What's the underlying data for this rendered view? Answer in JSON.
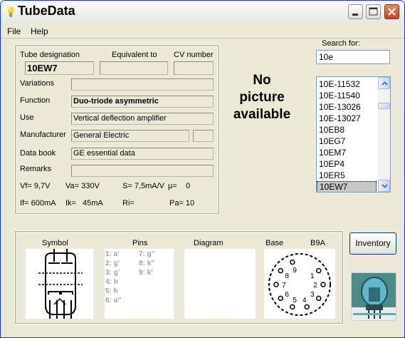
{
  "window": {
    "title": "TubeData"
  },
  "menu": {
    "file": "File",
    "help": "Help"
  },
  "designation": {
    "tube_label": "Tube designation",
    "equiv_label": "Equivalent to",
    "cv_label": "CV number",
    "tube_value": "10EW7",
    "equiv_value": "",
    "cv_value": ""
  },
  "details": {
    "variations_label": "Variations",
    "variations_value": "",
    "function_label": "Function",
    "function_value": "Duo-triode asymmetric",
    "use_label": "Use",
    "use_value": "Vertical deflection amplifier",
    "manufacturer_label": "Manufacturer",
    "manufacturer_value": "General Electric",
    "manufacturer_extra": "",
    "databook_label": "Data book",
    "databook_value": "GE essential data",
    "remarks_label": "Remarks",
    "remarks_value": ""
  },
  "params": {
    "vf": "Vf= 9,7V",
    "va": "Va= 330V",
    "s": "S= 7,5mA/V",
    "mu": "µ=",
    "mu_val": "0",
    "if": "If= 600mA",
    "ik": "Ik=",
    "ik_val": "45mA",
    "ri": "Ri=",
    "pa": "Pa= 10"
  },
  "picture": {
    "line1": "No",
    "line2": "picture",
    "line3": "available"
  },
  "search": {
    "label": "Search for:",
    "value": "10e",
    "results": [
      "10E-11532",
      "10E-11540",
      "10E-13026",
      "10E-13027",
      "10EB8",
      "10EG7",
      "10EM7",
      "10EP4",
      "10ER5",
      "10EW7"
    ],
    "selected": "10EW7"
  },
  "bottom": {
    "symbol_label": "Symbol",
    "pins_label": "Pins",
    "diagram_label": "Diagram",
    "base_label": "Base",
    "base_type": "B9A",
    "pins_left": [
      "1: a'",
      "2: g'",
      "3: g'",
      "4: h",
      "5: h",
      "6: a''"
    ],
    "pins_right": [
      "7: g''",
      "8: k''",
      "9: k'"
    ],
    "base_pins": [
      "1",
      "2",
      "3",
      "4",
      "5",
      "6",
      "7",
      "8",
      "9"
    ]
  },
  "buttons": {
    "inventory": "Inventory"
  },
  "icons": {
    "app": "lightbulb-icon",
    "minimize": "minimize-icon",
    "maximize": "maximize-icon",
    "close": "close-icon"
  },
  "colors": {
    "title_border": "#0831d9",
    "close_button": "#c84522",
    "list_selection": "#c8c8c8",
    "panel_bg": "#ece9d8"
  }
}
